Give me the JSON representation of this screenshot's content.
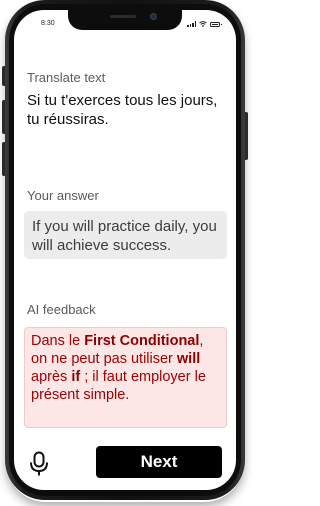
{
  "status_bar": {
    "time": "8:30"
  },
  "prompt": {
    "label": "Translate text",
    "text": "Si tu t'exerces tous les jours, tu réussiras."
  },
  "answer": {
    "label": "Your answer",
    "text": "If you will practice daily, you will achieve success."
  },
  "feedback": {
    "label": "AI feedback",
    "segments": [
      {
        "text": "Dans le ",
        "bold": false
      },
      {
        "text": "First Conditional",
        "bold": true
      },
      {
        "text": ", on ne peut pas utiliser ",
        "bold": false
      },
      {
        "text": "will",
        "bold": true
      },
      {
        "text": " après ",
        "bold": false
      },
      {
        "text": "if",
        "bold": true
      },
      {
        "text": " ; il faut employer le présent simple.",
        "bold": false
      }
    ],
    "text_color": "#a40000",
    "background_color": "#fde6e6"
  },
  "footer": {
    "mic_icon": "microphone-icon",
    "next_label": "Next"
  }
}
